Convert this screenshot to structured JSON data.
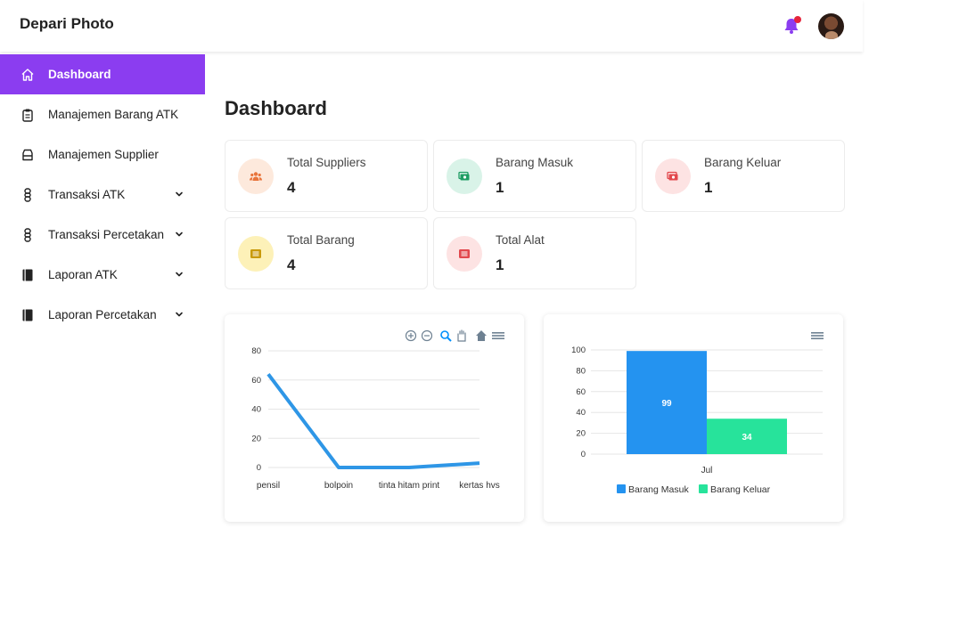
{
  "app": {
    "title": "Depari Photo"
  },
  "header": {
    "has_notification": true
  },
  "sidebar": {
    "items": [
      {
        "label": "Dashboard",
        "icon": "home-icon",
        "active": true,
        "expandable": false
      },
      {
        "label": "Manajemen Barang ATK",
        "icon": "clipboard-icon",
        "active": false,
        "expandable": false
      },
      {
        "label": "Manajemen Supplier",
        "icon": "box-icon",
        "active": false,
        "expandable": false
      },
      {
        "label": "Transaksi ATK",
        "icon": "chain-icon",
        "active": false,
        "expandable": true
      },
      {
        "label": "Transaksi Percetakan",
        "icon": "chain-icon",
        "active": false,
        "expandable": true
      },
      {
        "label": "Laporan ATK",
        "icon": "book-icon",
        "active": false,
        "expandable": true
      },
      {
        "label": "Laporan Percetakan",
        "icon": "book-icon",
        "active": false,
        "expandable": true
      }
    ]
  },
  "main": {
    "title": "Dashboard",
    "cards": [
      {
        "label": "Total Suppliers",
        "value": "4",
        "icon": "users-icon",
        "bg": "#fde9dc",
        "fg": "#e8743b"
      },
      {
        "label": "Barang Masuk",
        "value": "1",
        "icon": "money-icon",
        "bg": "#d9f3e8",
        "fg": "#1f9d63"
      },
      {
        "label": "Barang Keluar",
        "value": "1",
        "icon": "money-icon",
        "bg": "#fde3e3",
        "fg": "#e2484d"
      },
      {
        "label": "Total Barang",
        "value": "4",
        "icon": "list-icon",
        "bg": "#fdf1b8",
        "fg": "#c99a0b"
      },
      {
        "label": "Total Alat",
        "value": "1",
        "icon": "list-icon",
        "bg": "#fde3e3",
        "fg": "#e2484d"
      }
    ]
  },
  "chart_data": [
    {
      "type": "line",
      "categories": [
        "pensil",
        "bolpoin",
        "tinta hitam print",
        "kertas hvs"
      ],
      "values": [
        64,
        0,
        0,
        3
      ],
      "ylim": [
        0,
        80
      ],
      "yticks": [
        "80",
        "60",
        "40",
        "20",
        "0"
      ],
      "color": "#2e96e6",
      "grid": true,
      "toolbar": [
        "zoom-in-icon",
        "zoom-out-icon",
        "magnifier-icon",
        "pan-hand-icon",
        "home-icon",
        "menu-icon"
      ]
    },
    {
      "type": "bar",
      "categories": [
        "Jul"
      ],
      "series": [
        {
          "name": "Barang Masuk",
          "values": [
            99
          ],
          "color": "#2493f0"
        },
        {
          "name": "Barang Keluar",
          "values": [
            34
          ],
          "color": "#27e39b"
        }
      ],
      "ylim": [
        0,
        100
      ],
      "yticks": [
        "100",
        "80",
        "60",
        "40",
        "20",
        "0"
      ],
      "grid": true,
      "legend": "bottom",
      "toolbar": [
        "menu-icon"
      ]
    }
  ]
}
